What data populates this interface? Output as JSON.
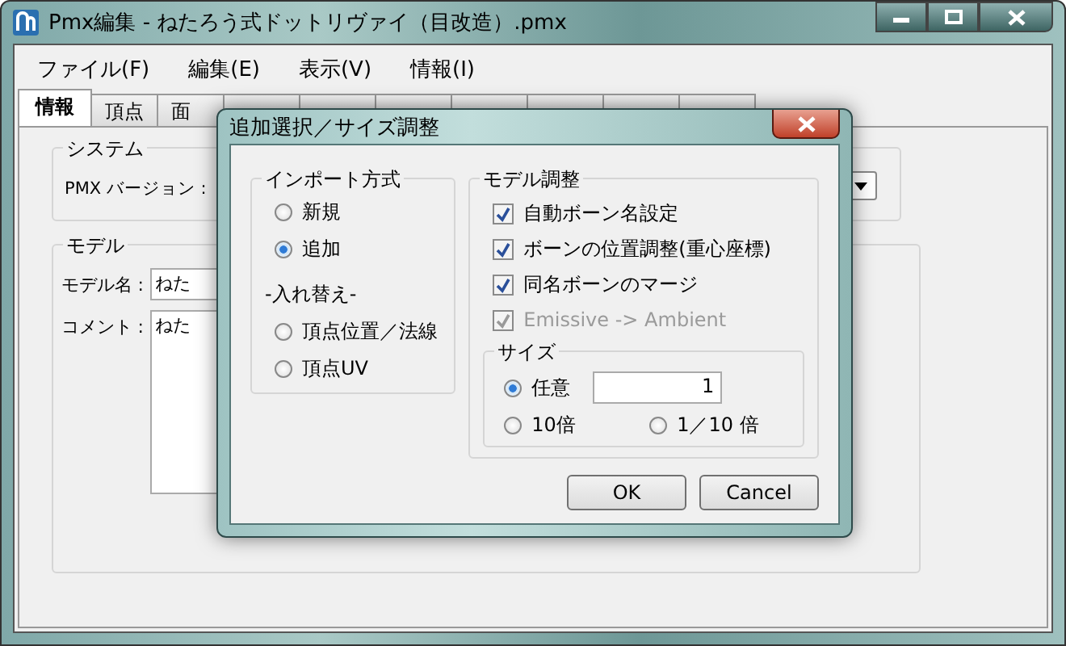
{
  "window": {
    "title": "Pmx編集 - ねたろう式ドットリヴァイ（目改造）.pmx"
  },
  "menu": [
    "ファイル(F)",
    "編集(E)",
    "表示(V)",
    "情報(I)"
  ],
  "tabs": [
    {
      "label": "情報",
      "selected": true
    },
    {
      "label": "頂点",
      "selected": false
    },
    {
      "label": "面",
      "selected": false
    }
  ],
  "system": {
    "title": "システム",
    "pmx_version_label": "PMX バージョン :"
  },
  "model": {
    "title": "モデル",
    "name_label": "モデル名 :",
    "name_value": "ねた",
    "comment_label": "コメント :",
    "comment_value": "ねた"
  },
  "dialog": {
    "title": "追加選択／サイズ調整",
    "import_group": {
      "title": "インポート方式",
      "options": [
        {
          "label": "新規",
          "selected": false
        },
        {
          "label": "追加",
          "selected": true
        }
      ],
      "replace_title": "-入れ替え-",
      "replace_options": [
        {
          "label": "頂点位置／法線",
          "selected": false
        },
        {
          "label": "頂点UV",
          "selected": false
        }
      ]
    },
    "adjust_group": {
      "title": "モデル調整",
      "checks": [
        {
          "label": "自動ボーン名設定",
          "checked": true,
          "disabled": false
        },
        {
          "label": "ボーンの位置調整(重心座標)",
          "checked": true,
          "disabled": false
        },
        {
          "label": "同名ボーンのマージ",
          "checked": true,
          "disabled": false
        },
        {
          "label": "Emissive -> Ambient",
          "checked": true,
          "disabled": true
        }
      ],
      "size": {
        "title": "サイズ",
        "options": [
          {
            "label": "任意",
            "selected": true
          },
          {
            "label": "10倍",
            "selected": false
          },
          {
            "label": "1／10 倍",
            "selected": false
          }
        ],
        "value": "1"
      }
    },
    "buttons": [
      "OK",
      "Cancel"
    ]
  }
}
